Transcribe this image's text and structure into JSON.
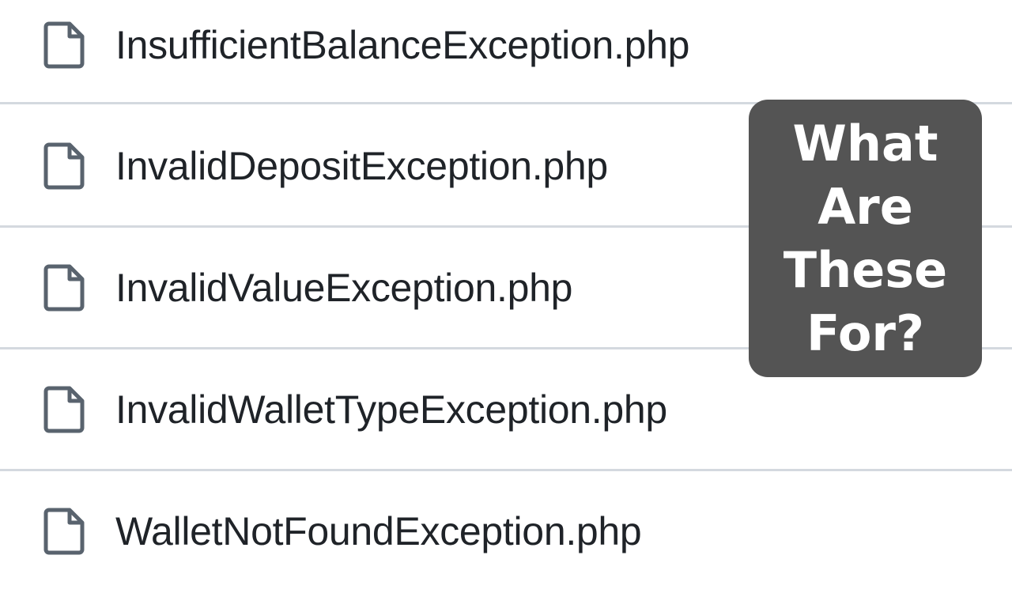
{
  "files": [
    {
      "name": "InsufficientBalanceException.php",
      "icon": "file-icon"
    },
    {
      "name": "InvalidDepositException.php",
      "icon": "file-icon"
    },
    {
      "name": "InvalidValueException.php",
      "icon": "file-icon"
    },
    {
      "name": "InvalidWalletTypeException.php",
      "icon": "file-icon"
    },
    {
      "name": "WalletNotFoundException.php",
      "icon": "file-icon"
    }
  ],
  "overlay": {
    "lines": [
      "What",
      "Are",
      "These",
      "For?"
    ]
  },
  "colors": {
    "background": "#ffffff",
    "text": "#1f2328",
    "icon": "#59636e",
    "divider": "#d4d9df",
    "overlay_bg": "#545454",
    "overlay_text": "#ffffff"
  }
}
